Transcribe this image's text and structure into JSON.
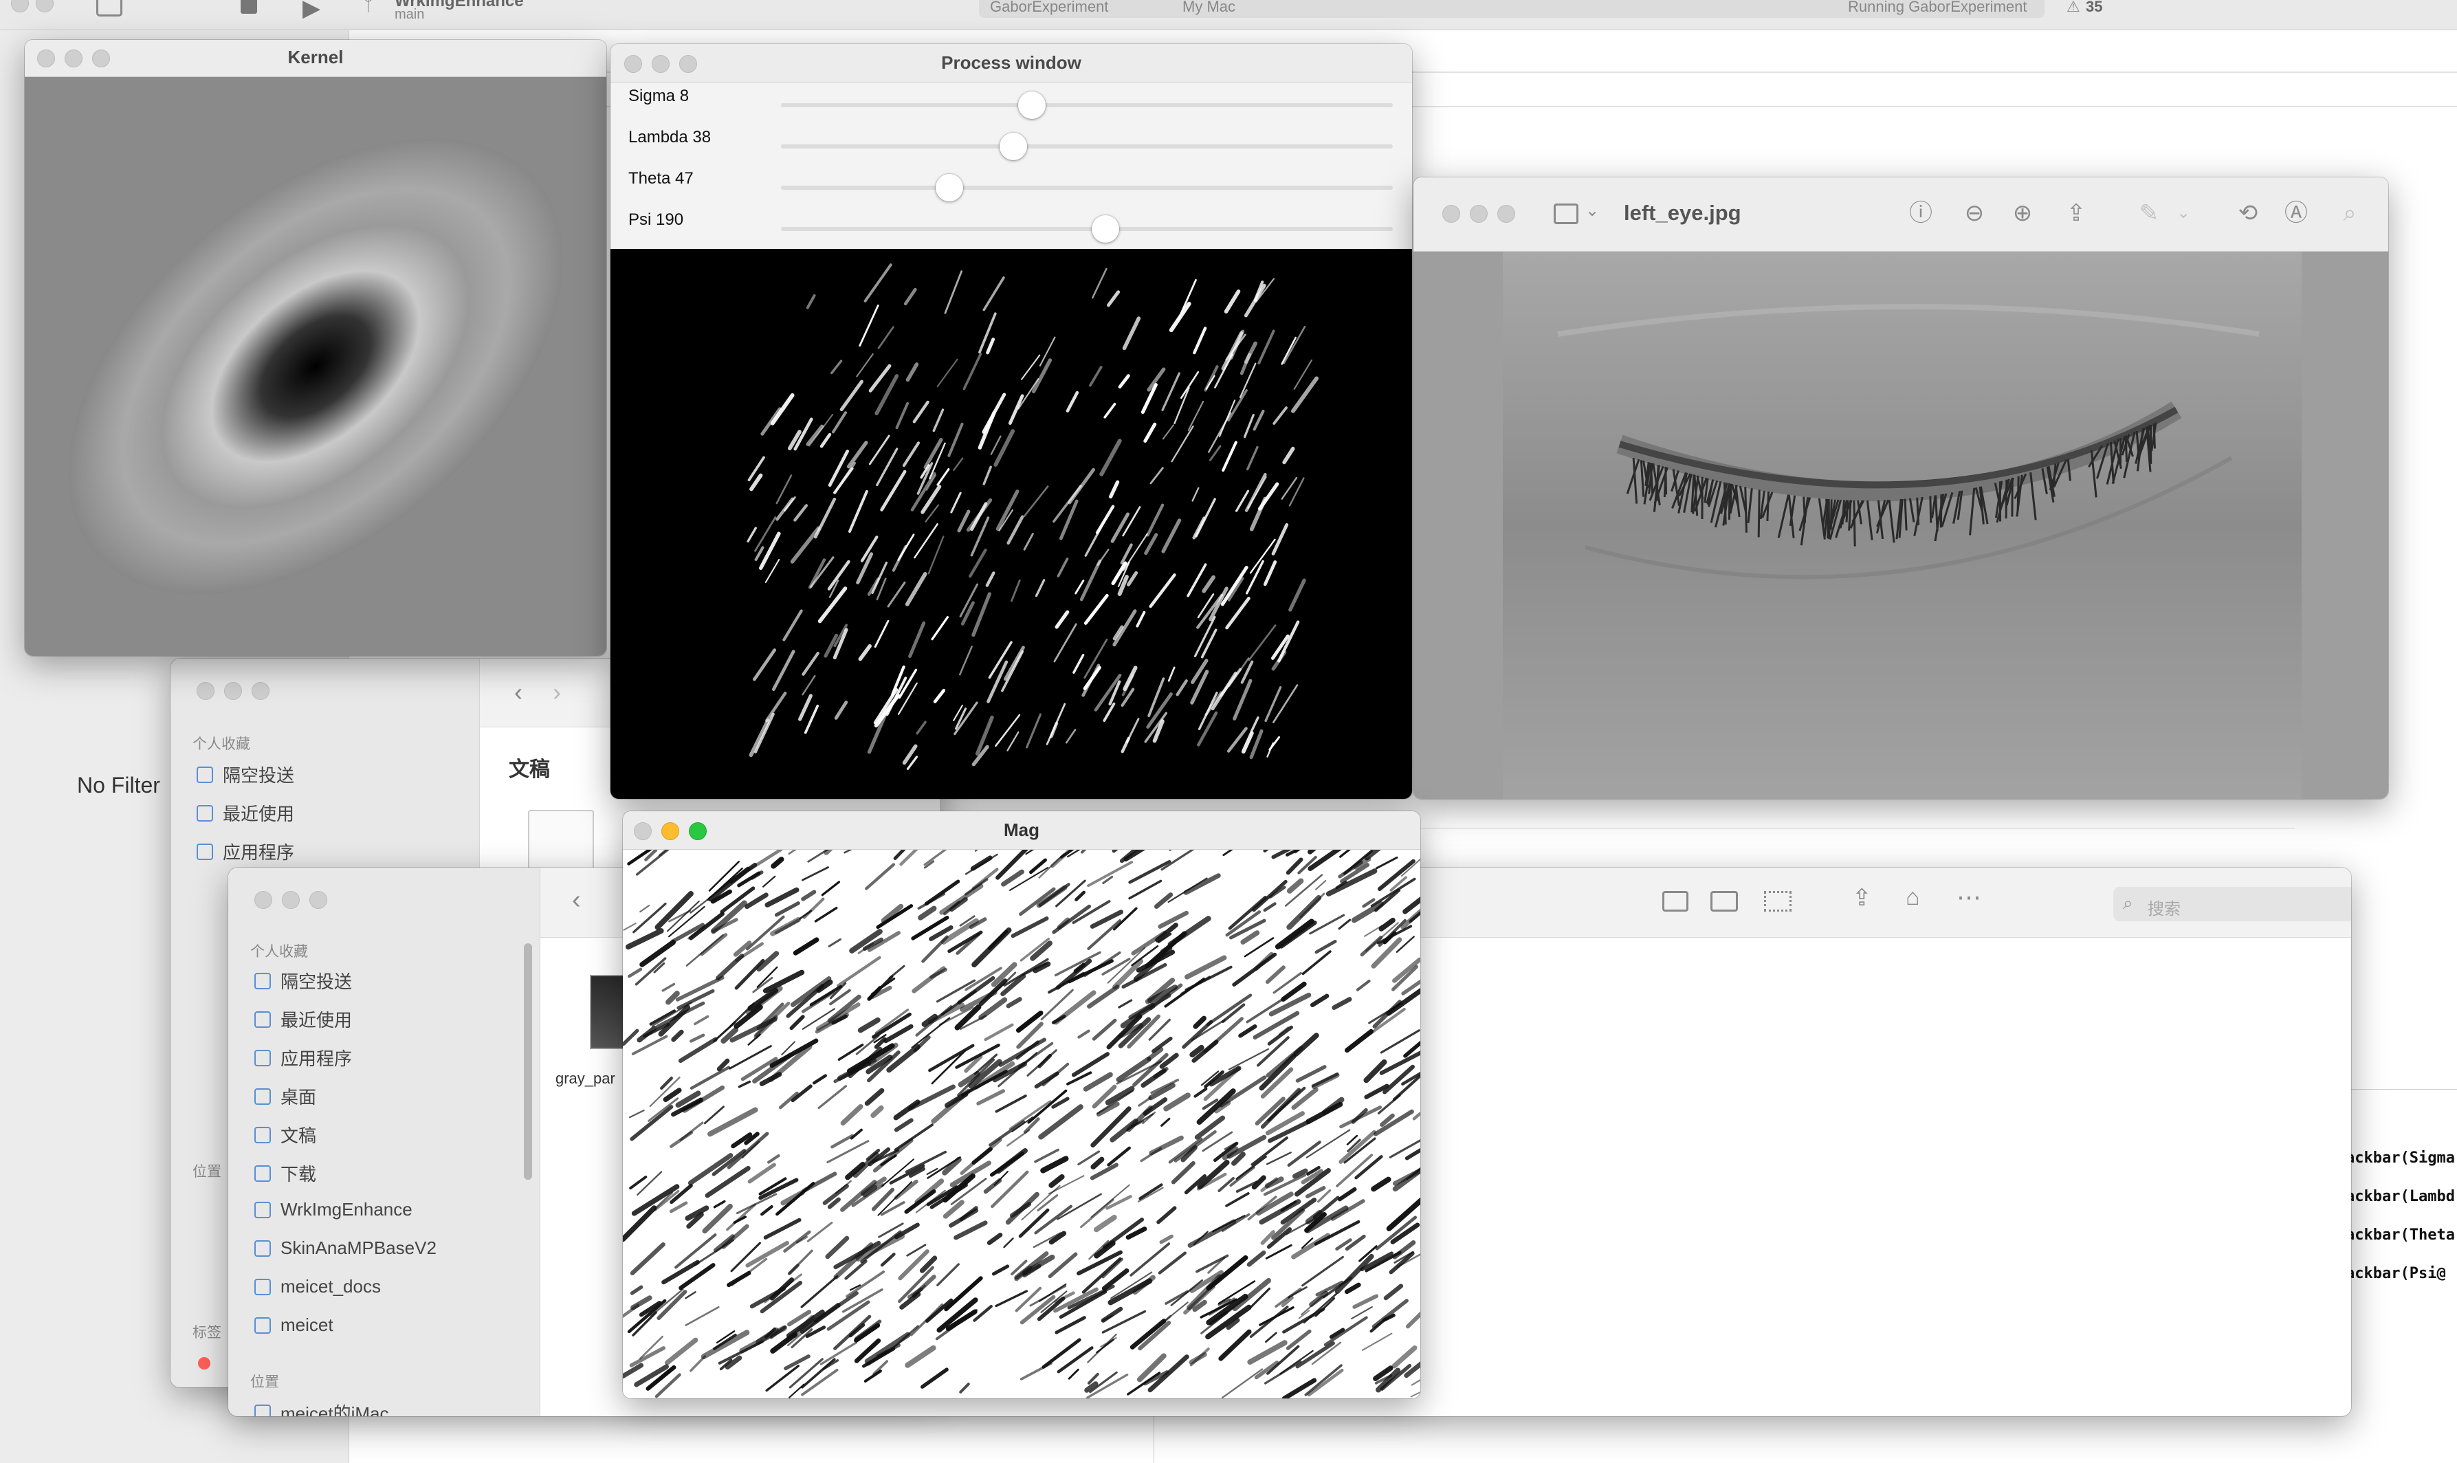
{
  "xcode": {
    "branch": "WrkImgEnhance",
    "branch_sub": "main",
    "scheme": "GaborExperiment",
    "destination": "My Mac",
    "status": "Running GaborExperiment",
    "warnings": "35",
    "no_filter": "No Filter",
    "code_fragments": [
      "ackbar(Sigma",
      "ackbar(Lambd",
      "ackbar(Theta",
      "ackbar(Psi@"
    ]
  },
  "kernel_window": {
    "title": "Kernel"
  },
  "process_window": {
    "title": "Process window",
    "sliders": [
      {
        "label": "Sigma 8",
        "value": 0.41
      },
      {
        "label": "Lambda 38",
        "value": 0.38
      },
      {
        "label": "Theta 47",
        "value": 0.275
      },
      {
        "label": "Psi 190",
        "value": 0.53
      }
    ]
  },
  "preview_window": {
    "title": "left_eye.jpg"
  },
  "mag_window": {
    "title": "Mag"
  },
  "finder_back": {
    "section": "个人收藏",
    "items": [
      "隔空投送",
      "最近使用",
      "应用程序"
    ],
    "content_title": "文稿"
  },
  "finder_front": {
    "section_fav": "个人收藏",
    "items": [
      "隔空投送",
      "最近使用",
      "应用程序",
      "桌面",
      "文稿",
      "下载",
      "WrkImgEnhance",
      "SkinAnaMPBaseV2",
      "meicet_docs",
      "meicet"
    ],
    "section_loc": "位置",
    "loc_item": "meicet的iMac",
    "file_name": "gray_par",
    "search_placeholder": "搜索"
  },
  "back_finder_extra": {
    "loc": "位置",
    "tags": "标签"
  },
  "colors": {
    "close": "#ff5f57",
    "minimize": "#febc2e",
    "zoom": "#28c840",
    "accent": "#2f7bf5"
  }
}
